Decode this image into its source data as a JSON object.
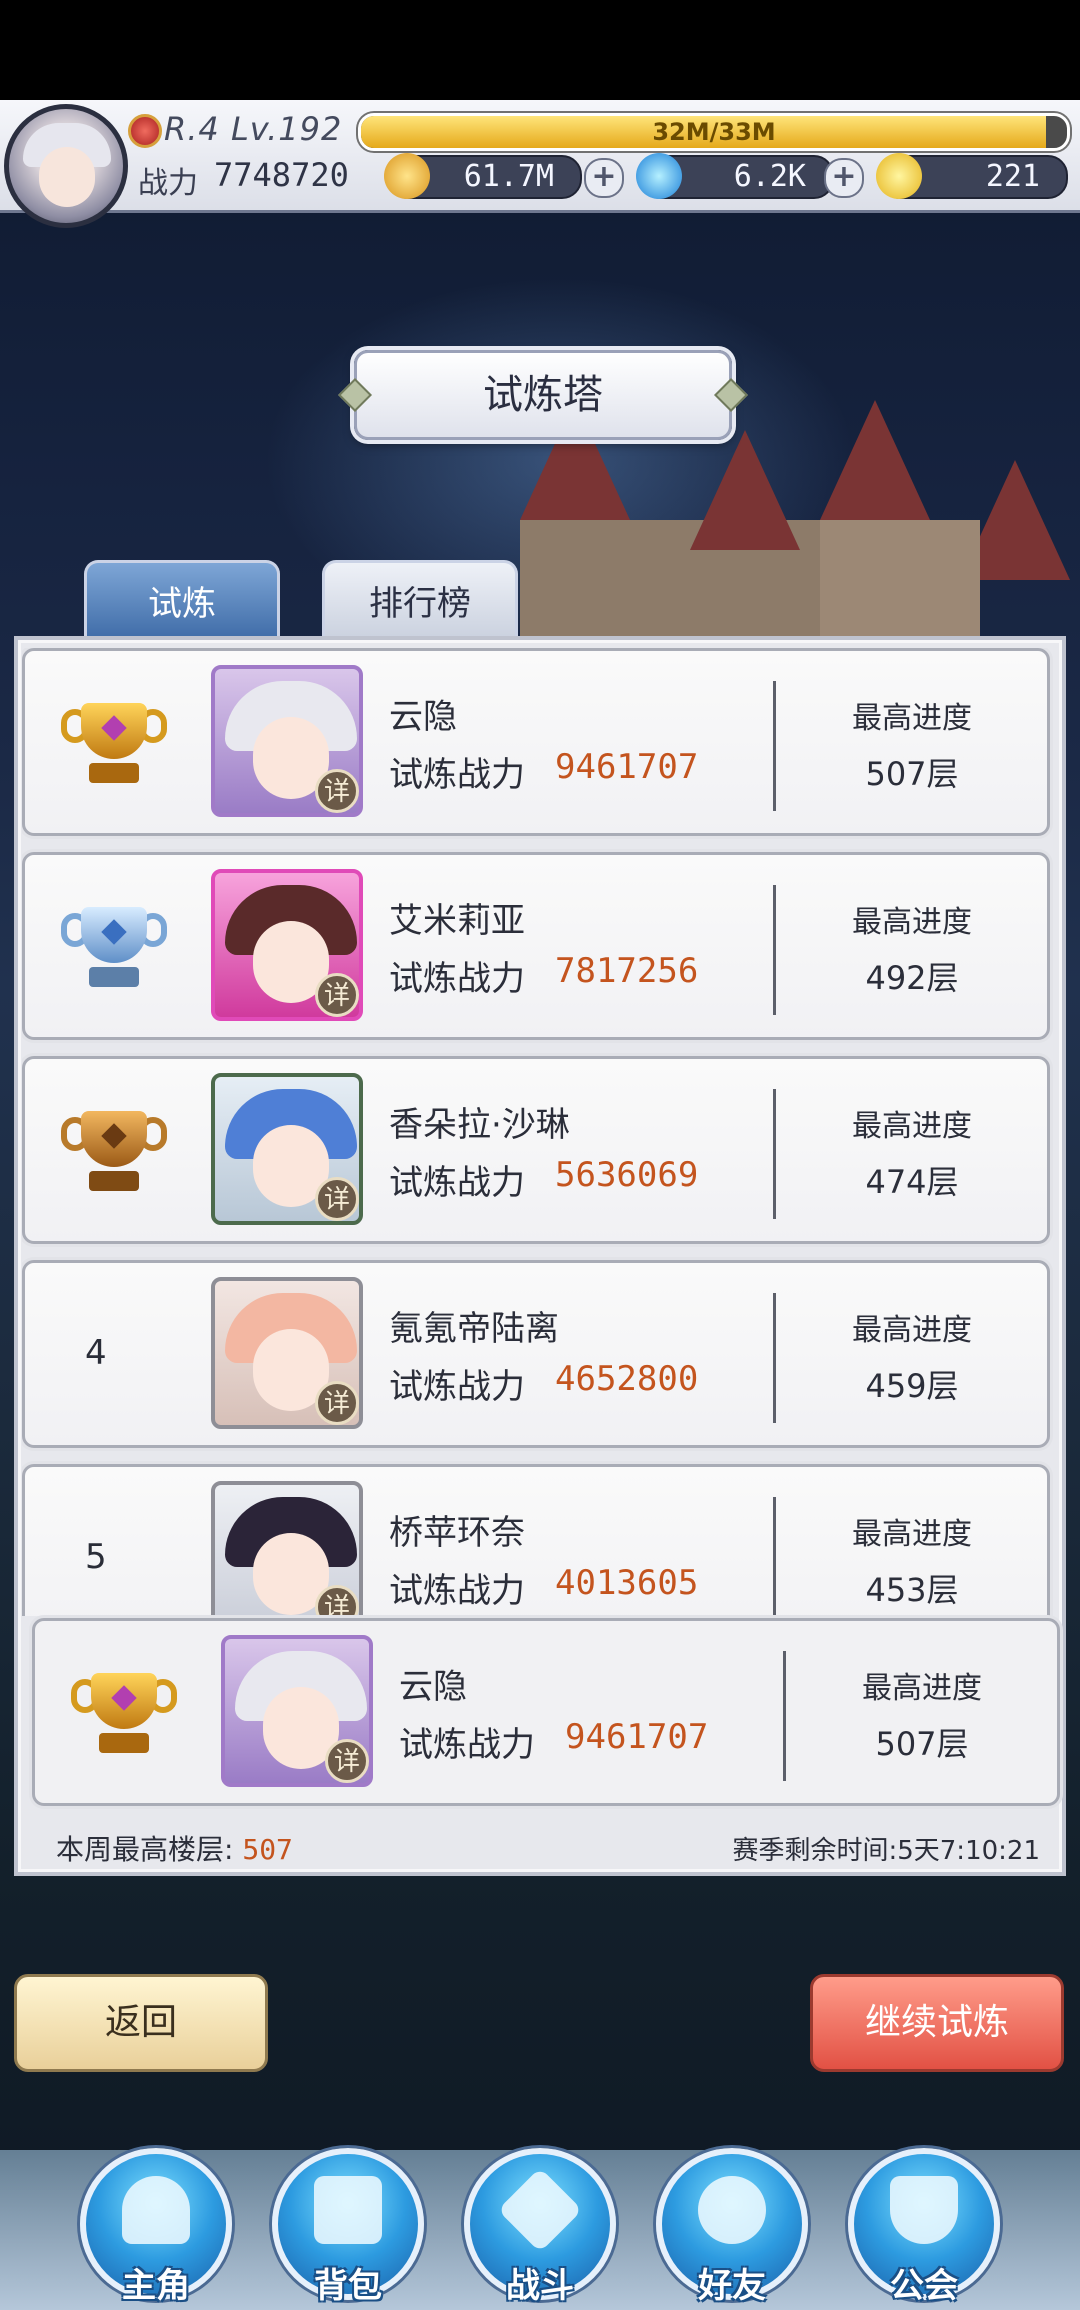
{
  "player": {
    "rank_level": "R.4 Lv.192",
    "power_label": "战力",
    "power_value": "7748720",
    "exp_text": "32M/33M",
    "exp_fraction": 0.97
  },
  "currencies": [
    {
      "icon": "gold-coin-icon",
      "value": "61.7M"
    },
    {
      "icon": "blue-crystal-icon",
      "value": "6.2K"
    },
    {
      "icon": "yellow-gem-icon",
      "value": "221"
    }
  ],
  "page_title": "试炼塔",
  "tabs": [
    {
      "label": "试炼",
      "active": true
    },
    {
      "label": "排行榜",
      "active": false
    }
  ],
  "common": {
    "power_label": "试炼战力",
    "progress_label": "最高进度",
    "detail_label": "详"
  },
  "ranking": [
    {
      "rank": "1",
      "badge": "gold-trophy-icon",
      "name": "云隐",
      "power": "9461707",
      "progress": "507层"
    },
    {
      "rank": "2",
      "badge": "silver-trophy-icon",
      "name": "艾米莉亚",
      "power": "7817256",
      "progress": "492层"
    },
    {
      "rank": "3",
      "badge": "bronze-trophy-icon",
      "name": "香朵拉·沙琳",
      "power": "5636069",
      "progress": "474层"
    },
    {
      "rank": "4",
      "badge": "",
      "name": "氪氪帝陆离",
      "power": "4652800",
      "progress": "459层"
    },
    {
      "rank": "5",
      "badge": "",
      "name": "桥苹环奈",
      "power": "4013605",
      "progress": "453层"
    }
  ],
  "self_entry": {
    "badge": "gold-trophy-icon",
    "name": "云隐",
    "power": "9461707",
    "progress": "507层"
  },
  "footer": {
    "weekly_label": "本周最高楼层:",
    "weekly_value": "507",
    "season_label": "赛季剩余时间:",
    "season_value": "5天7:10:21"
  },
  "buttons": {
    "back": "返回",
    "continue": "继续试炼"
  },
  "nav": [
    {
      "label": "主角",
      "icon": "hero-icon"
    },
    {
      "label": "背包",
      "icon": "backpack-icon"
    },
    {
      "label": "战斗",
      "icon": "crossed-swords-icon"
    },
    {
      "label": "好友",
      "icon": "handshake-icon"
    },
    {
      "label": "公会",
      "icon": "guild-crest-icon"
    }
  ],
  "colors": {
    "accent_orange": "#c4541e",
    "continue_red": "#e25144",
    "nav_blue": "#2d9be0"
  }
}
